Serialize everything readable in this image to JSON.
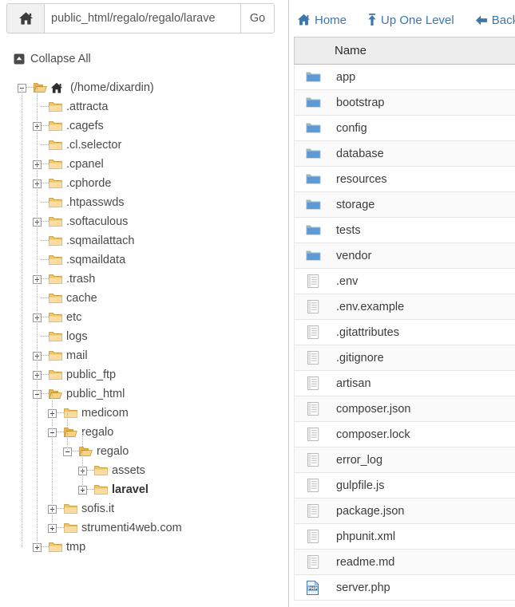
{
  "addressbar": {
    "home_icon": "home-icon",
    "path_value": "public_html/regalo/regalo/larave",
    "path_placeholder": "",
    "go_label": "Go"
  },
  "tree": {
    "collapse_all_label": "Collapse All",
    "collapse_all_icon": "collapse-all-icon",
    "root": {
      "label": "(/home/dixardin)",
      "icon": "open-folder-home-icon",
      "toggle": "minus"
    },
    "items": [
      {
        "label": ".attracta",
        "depth": 1,
        "toggle": "none",
        "icon": "folder-icon"
      },
      {
        "label": ".cagefs",
        "depth": 1,
        "toggle": "plus",
        "icon": "folder-icon"
      },
      {
        "label": ".cl.selector",
        "depth": 1,
        "toggle": "none",
        "icon": "folder-icon"
      },
      {
        "label": ".cpanel",
        "depth": 1,
        "toggle": "plus",
        "icon": "folder-icon"
      },
      {
        "label": ".cphorde",
        "depth": 1,
        "toggle": "plus",
        "icon": "folder-icon"
      },
      {
        "label": ".htpasswds",
        "depth": 1,
        "toggle": "none",
        "icon": "folder-icon"
      },
      {
        "label": ".softaculous",
        "depth": 1,
        "toggle": "plus",
        "icon": "folder-icon"
      },
      {
        "label": ".sqmailattach",
        "depth": 1,
        "toggle": "none",
        "icon": "folder-icon"
      },
      {
        "label": ".sqmaildata",
        "depth": 1,
        "toggle": "none",
        "icon": "folder-icon"
      },
      {
        "label": ".trash",
        "depth": 1,
        "toggle": "plus",
        "icon": "folder-icon"
      },
      {
        "label": "cache",
        "depth": 1,
        "toggle": "none",
        "icon": "folder-icon"
      },
      {
        "label": "etc",
        "depth": 1,
        "toggle": "plus",
        "icon": "folder-icon"
      },
      {
        "label": "logs",
        "depth": 1,
        "toggle": "none",
        "icon": "folder-icon"
      },
      {
        "label": "mail",
        "depth": 1,
        "toggle": "plus",
        "icon": "folder-icon"
      },
      {
        "label": "public_ftp",
        "depth": 1,
        "toggle": "plus",
        "icon": "folder-icon"
      },
      {
        "label": "public_html",
        "depth": 1,
        "toggle": "minus",
        "icon": "open-folder-icon"
      },
      {
        "label": "medicom",
        "depth": 2,
        "toggle": "plus",
        "icon": "folder-icon"
      },
      {
        "label": "regalo",
        "depth": 2,
        "toggle": "minus",
        "icon": "open-folder-icon"
      },
      {
        "label": "regalo",
        "depth": 3,
        "toggle": "minus",
        "icon": "open-folder-icon"
      },
      {
        "label": "assets",
        "depth": 4,
        "toggle": "plus",
        "icon": "folder-icon"
      },
      {
        "label": "laravel",
        "depth": 4,
        "toggle": "plus",
        "icon": "folder-icon",
        "bold": true
      },
      {
        "label": "sofis.it",
        "depth": 2,
        "toggle": "plus",
        "icon": "folder-icon"
      },
      {
        "label": "strumenti4web.com",
        "depth": 2,
        "toggle": "plus",
        "icon": "folder-icon"
      },
      {
        "label": "tmp",
        "depth": 1,
        "toggle": "plus",
        "icon": "folder-icon"
      }
    ]
  },
  "toolbar": {
    "links": [
      {
        "label": "Home",
        "icon": "home-icon"
      },
      {
        "label": "Up One Level",
        "icon": "up-one-level-icon"
      },
      {
        "label": "Back",
        "icon": "back-arrow-icon"
      }
    ]
  },
  "filelist": {
    "column_header": "Name",
    "rows": [
      {
        "name": "app",
        "type": "folder"
      },
      {
        "name": "bootstrap",
        "type": "folder"
      },
      {
        "name": "config",
        "type": "folder"
      },
      {
        "name": "database",
        "type": "folder"
      },
      {
        "name": "resources",
        "type": "folder"
      },
      {
        "name": "storage",
        "type": "folder"
      },
      {
        "name": "tests",
        "type": "folder"
      },
      {
        "name": "vendor",
        "type": "folder"
      },
      {
        "name": ".env",
        "type": "file"
      },
      {
        "name": ".env.example",
        "type": "file"
      },
      {
        "name": ".gitattributes",
        "type": "file"
      },
      {
        "name": ".gitignore",
        "type": "file"
      },
      {
        "name": "artisan",
        "type": "file"
      },
      {
        "name": "composer.json",
        "type": "file"
      },
      {
        "name": "composer.lock",
        "type": "file"
      },
      {
        "name": "error_log",
        "type": "file"
      },
      {
        "name": "gulpfile.js",
        "type": "file"
      },
      {
        "name": "package.json",
        "type": "file"
      },
      {
        "name": "phpunit.xml",
        "type": "file"
      },
      {
        "name": "readme.md",
        "type": "file"
      },
      {
        "name": "server.php",
        "type": "php"
      }
    ]
  },
  "colors": {
    "link": "#3c77ab",
    "folder_tree": "#f0c060",
    "folder_list": "#5a9bd5",
    "header_bg": "#ededed"
  }
}
